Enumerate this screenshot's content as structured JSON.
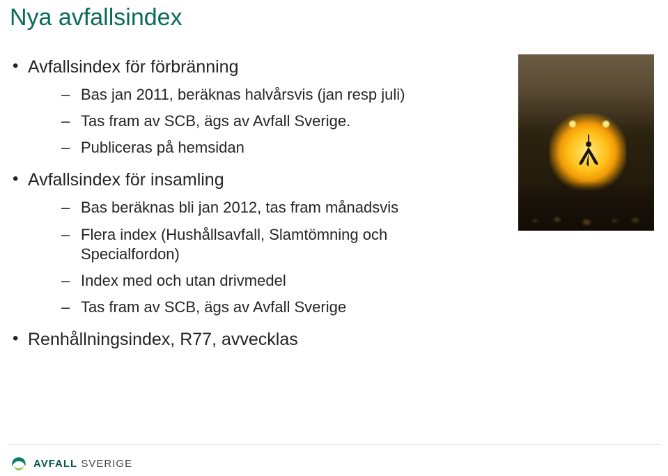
{
  "title": "Nya avfallsindex",
  "bullets": {
    "b1": {
      "text": "Avfallsindex för förbränning",
      "sub": {
        "s1": "Bas jan 2011, beräknas halvårsvis (jan resp juli)",
        "s2": "Tas fram av SCB, ägs av Avfall Sverige.",
        "s3": "Publiceras på hemsidan"
      }
    },
    "b2": {
      "text": "Avfallsindex för insamling",
      "sub": {
        "s1": "Bas beräknas bli jan 2012, tas fram månadsvis",
        "s2": "Flera index (Hushållsavfall, Slamtömning och Specialfordon)",
        "s3": "Index med och utan drivmedel",
        "s4": "Tas fram av SCB, ägs av Avfall Sverige"
      }
    },
    "b3": {
      "text": "Renhållningsindex, R77, avvecklas"
    }
  },
  "logo": {
    "brand1": "AVFALL",
    "brand2": "SVERIGE"
  },
  "image": {
    "alt": "waste-incineration-crane-photo"
  }
}
